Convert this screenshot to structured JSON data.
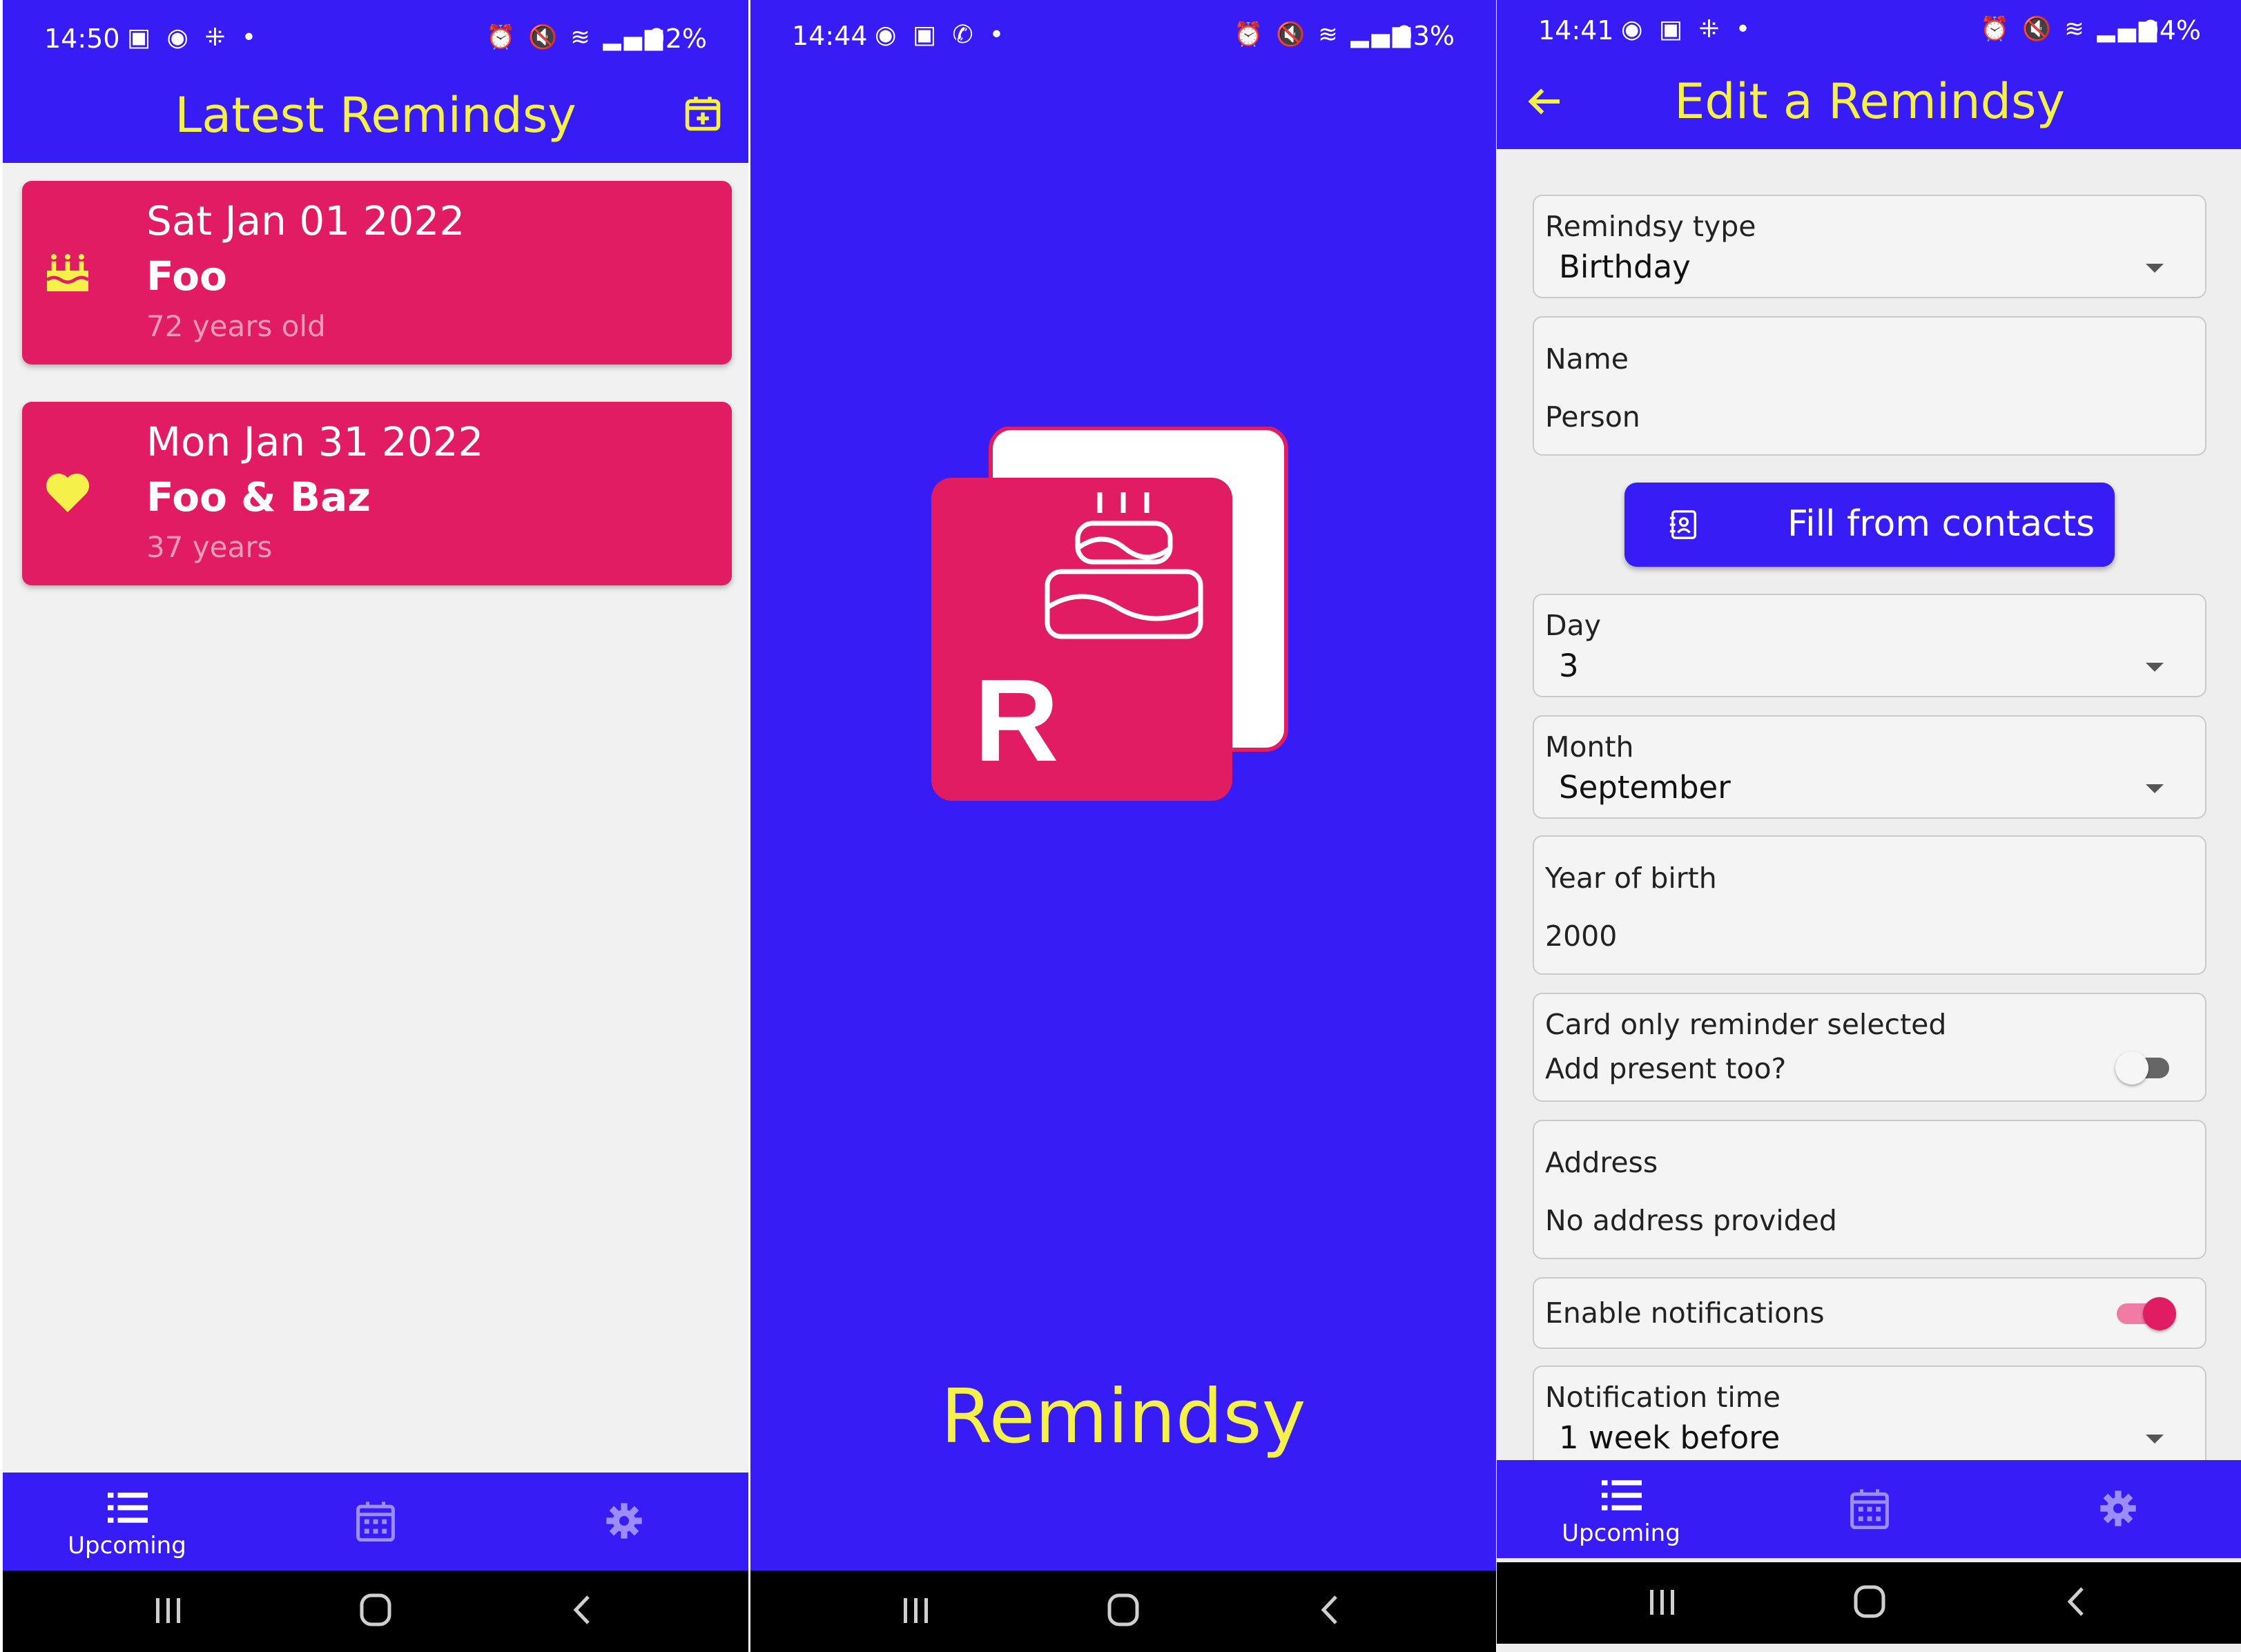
{
  "colors": {
    "primary": "#381cf5",
    "accent": "#e11c63",
    "title_yellow": "#f6f04a",
    "background": "#f1f1f1",
    "nav_bar": "#000000"
  },
  "screen1": {
    "status": {
      "time": "14:50",
      "battery": "92%"
    },
    "title": "Latest Remindsy",
    "add_icon": "calendar-plus-icon",
    "cards": [
      {
        "date": "Sat Jan 01 2022",
        "name": "Foo",
        "sub": "72 years old",
        "icon": "birthday-cake-icon"
      },
      {
        "date": "Mon Jan 31 2022",
        "name": "Foo & Baz",
        "sub": "37 years",
        "icon": "heart-icon"
      }
    ],
    "nav": {
      "upcoming": "Upcoming"
    }
  },
  "screen2": {
    "status": {
      "time": "14:44",
      "battery": "93%"
    },
    "logo_letter": "R",
    "title": "Remindsy"
  },
  "screen3": {
    "status": {
      "time": "14:41",
      "battery": "94%"
    },
    "title": "Edit a Remindsy",
    "form": {
      "type_label": "Remindsy type",
      "type_value": "Birthday",
      "name_label": "Name",
      "name_value": "Person",
      "fill_button": "Fill from contacts",
      "day_label": "Day",
      "day_value": "3",
      "month_label": "Month",
      "month_value": "September",
      "year_label": "Year of birth",
      "year_value": "2000",
      "card_only_text": "Card only reminder selected",
      "present_text": "Add present too?",
      "present_toggle": false,
      "address_label": "Address",
      "address_value": "No address provided",
      "notifications_label": "Enable notifications",
      "notifications_toggle": true,
      "notif_time_label": "Notification time",
      "notif_time_value": "1 week before"
    },
    "nav": {
      "upcoming": "Upcoming"
    }
  }
}
